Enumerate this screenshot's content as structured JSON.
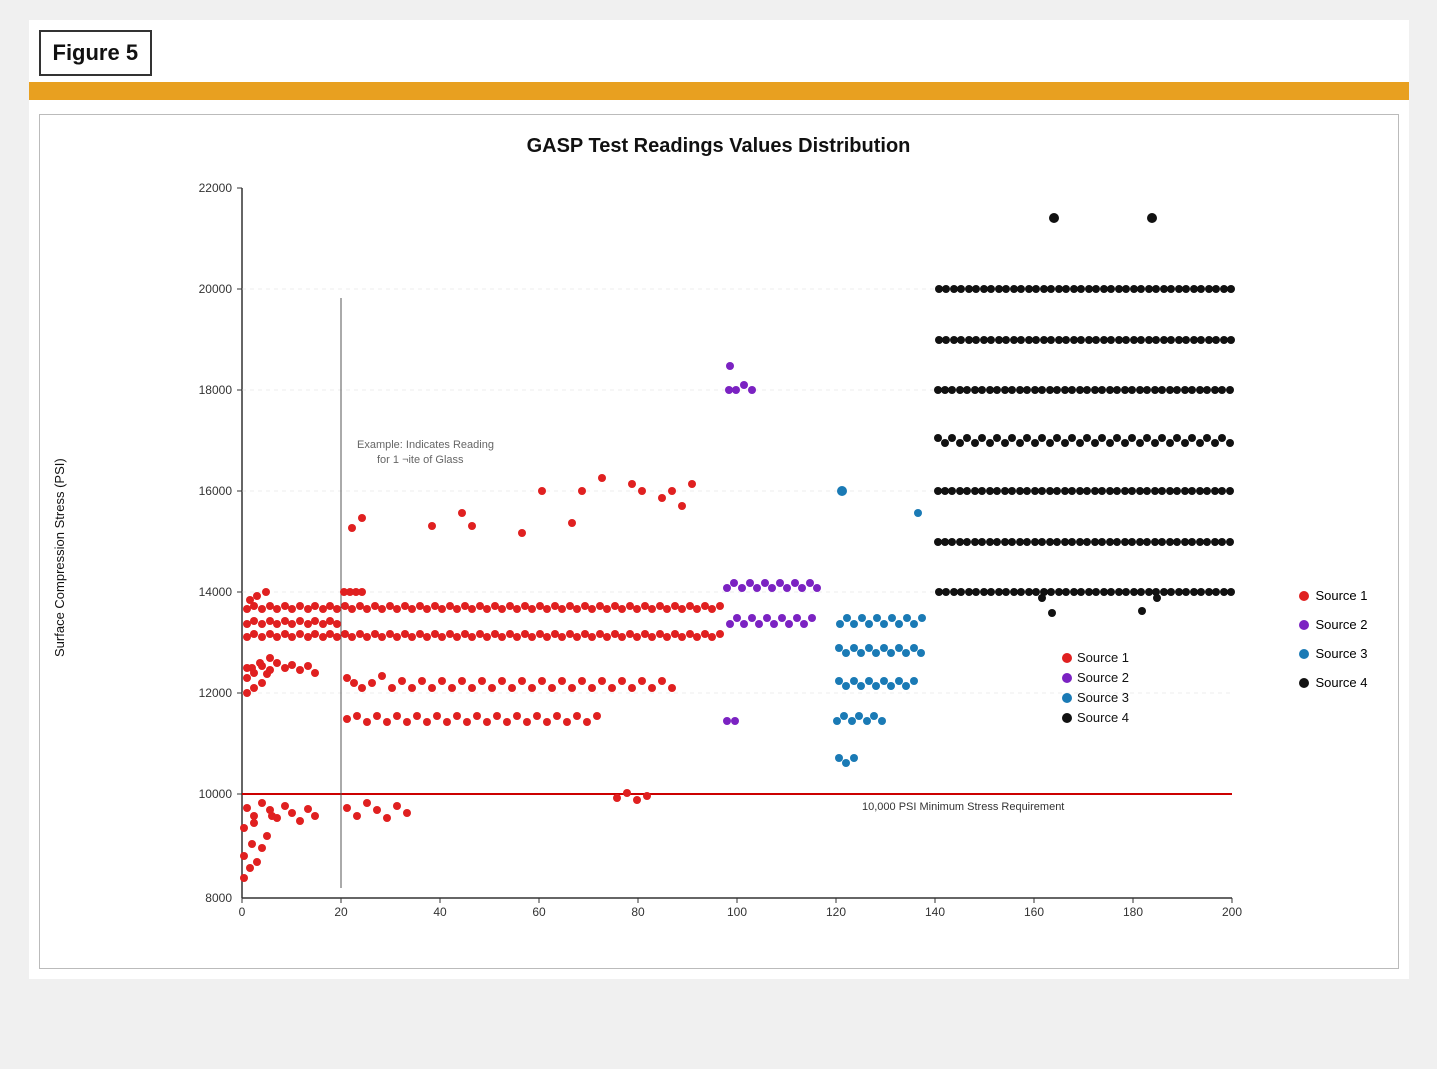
{
  "figure": {
    "label": "Figure 5",
    "gold_bar": true,
    "chart_title": "GASP Test Readings Values Distribution",
    "y_axis_label": "Surface Compression Stress (PSI)",
    "x_axis": {
      "min": 0,
      "max": 200,
      "ticks": [
        0,
        20,
        40,
        60,
        80,
        100,
        120,
        140,
        160,
        180,
        200
      ]
    },
    "y_axis": {
      "min": 8000,
      "max": 22000,
      "ticks": [
        8000,
        10000,
        12000,
        14000,
        16000,
        18000,
        20000,
        22000
      ]
    },
    "min_stress_line": {
      "value": 10000,
      "label": "10,000 PSI Minimum Stress Requirement"
    },
    "annotation": {
      "text1": "Example: Indicates Reading",
      "text2": "for 1 ¬ite of Glass"
    },
    "legend": [
      {
        "id": "source1",
        "label": "Source 1",
        "color": "#e02020"
      },
      {
        "id": "source2",
        "label": "Source 2",
        "color": "#7b22c2"
      },
      {
        "id": "source3",
        "label": "Source 3",
        "color": "#1a7ab5"
      },
      {
        "id": "source4",
        "label": "Source 4",
        "color": "#111111"
      }
    ]
  }
}
